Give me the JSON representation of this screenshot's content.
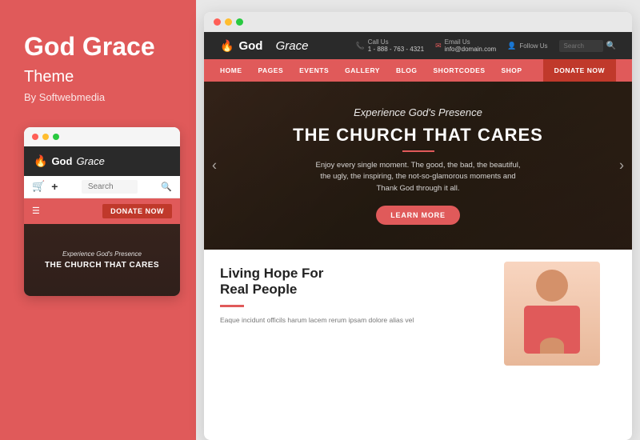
{
  "left": {
    "title": "God Grace",
    "subtitle": "Theme",
    "by": "By Softwebmedia"
  },
  "mobile": {
    "logo_text_bold": "God",
    "logo_text_italic": "Grace",
    "search_placeholder": "Search",
    "donate_btn": "DONATE NOW",
    "hero_sub": "Experience God's Presence",
    "hero_title": "THE CHURCH THAT CARES"
  },
  "desktop": {
    "logo_bold": "God",
    "logo_italic": "Grace",
    "call_label": "Call Us",
    "call_value": "1 - 888 - 763 - 4321",
    "email_label": "Email Us",
    "email_value": "info@domain.com",
    "follow_label": "Follow Us",
    "search_placeholder": "Search",
    "nav": {
      "home": "HOME",
      "pages": "PAGES",
      "events": "EVENTS",
      "gallery": "GALLERY",
      "blog": "BLOG",
      "shortcodes": "SHORTCODES",
      "shop": "SHOP",
      "donate": "DONATE NOW"
    },
    "hero": {
      "sub": "Experience God's Presence",
      "title": "THE CHURCH THAT CARES",
      "text": "Enjoy every single moment. The good, the bad, the beautiful, the ugly, the inspiring, the not-so-glamorous moments and Thank God through it all.",
      "btn": "LEARN MORE"
    },
    "content": {
      "title": "Living Hope For\nReal People",
      "text": "Eaque incidunt officils harum lacem rerum ipsam dolore alias vel"
    }
  },
  "colors": {
    "accent": "#e05a5a",
    "dark": "#2a2a2a",
    "nav_bg": "#e05a5a",
    "donate_dark": "#c0392b"
  }
}
